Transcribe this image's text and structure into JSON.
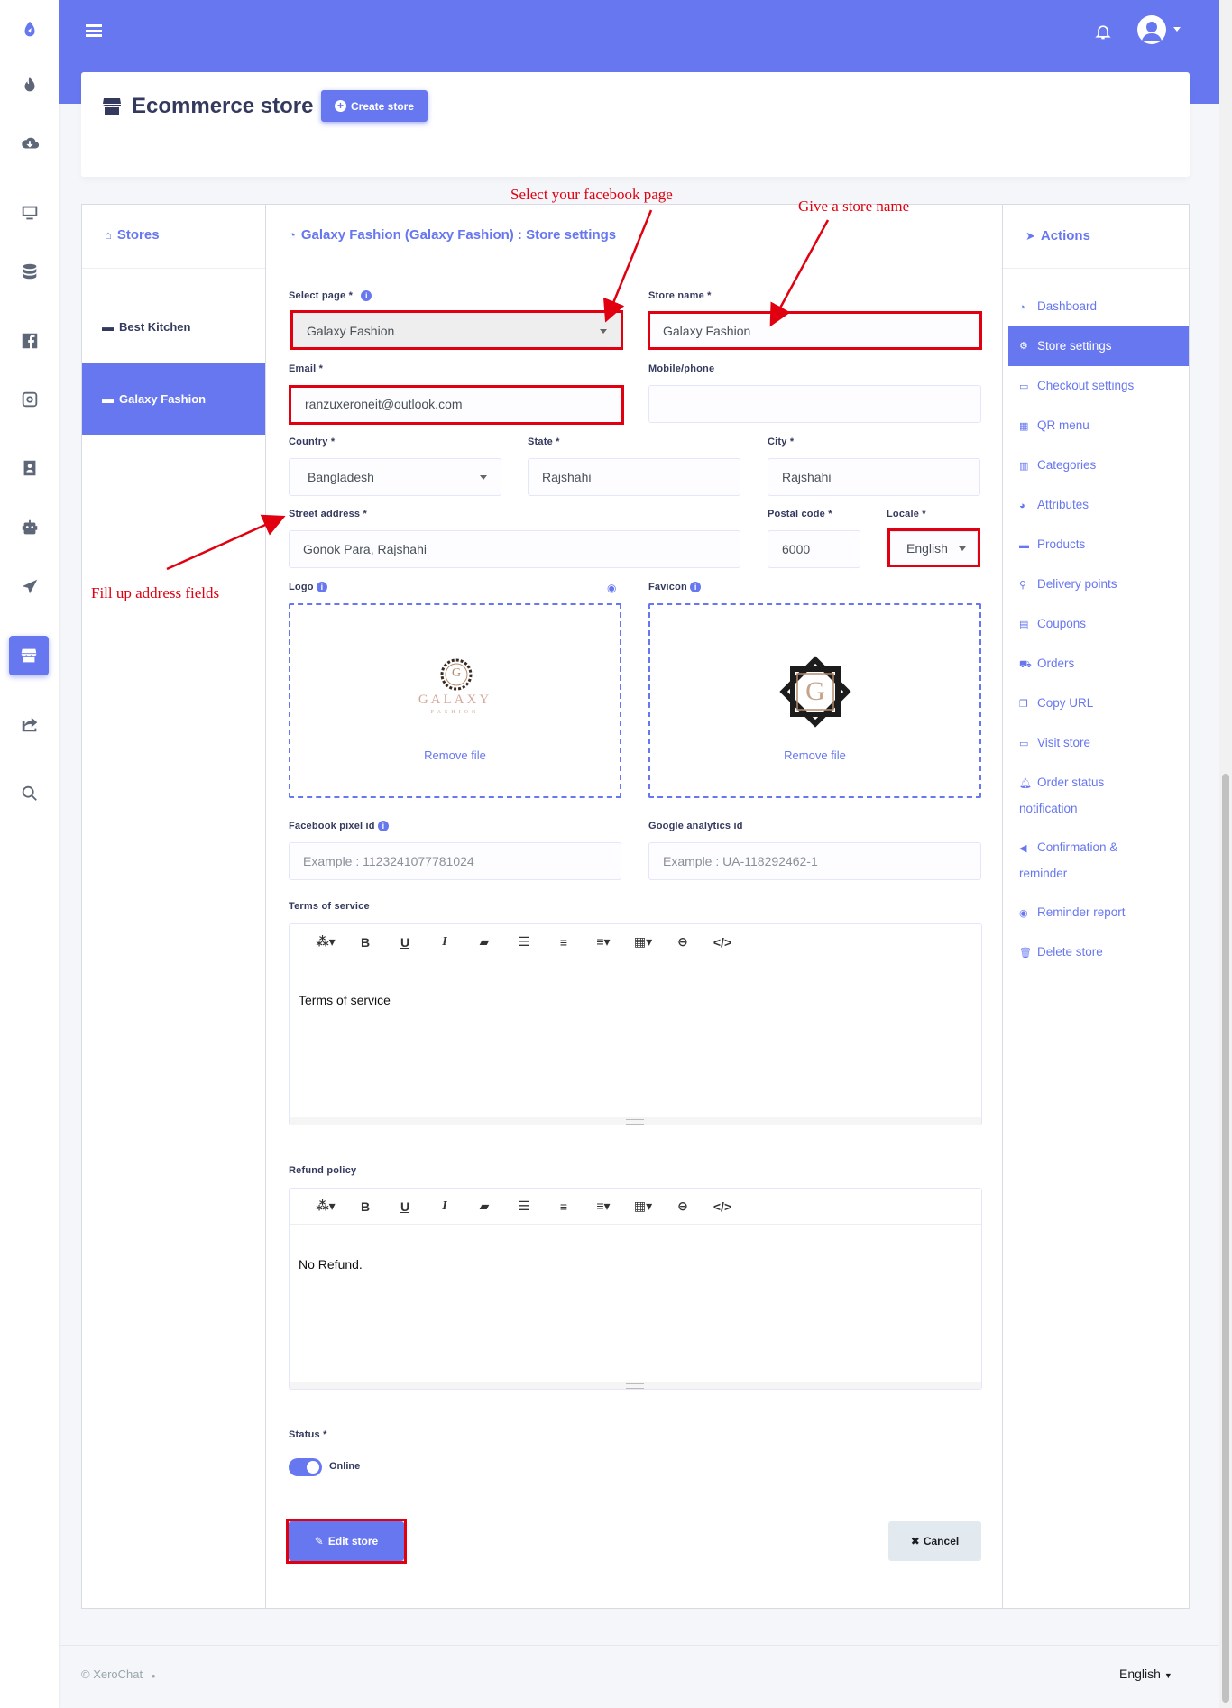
{
  "topbar": {
    "menu_icon": "hamburger-icon",
    "bell_icon": "bell-icon",
    "avatar_icon": "user-avatar-icon"
  },
  "header": {
    "title": "Ecommerce store",
    "create_button": "Create store"
  },
  "stores_panel": {
    "title": "Stores",
    "items": [
      {
        "label": "Best Kitchen"
      },
      {
        "label": "Galaxy Fashion"
      }
    ]
  },
  "settings": {
    "title": "Galaxy Fashion (Galaxy Fashion) : Store settings",
    "select_page": {
      "label": "Select page *",
      "value": "Galaxy Fashion"
    },
    "store_name": {
      "label": "Store name *",
      "value": "Galaxy Fashion"
    },
    "email": {
      "label": "Email *",
      "value": "ranzuxeroneit@outlook.com"
    },
    "mobile": {
      "label": "Mobile/phone",
      "value": ""
    },
    "country": {
      "label": "Country *",
      "value": "Bangladesh"
    },
    "state": {
      "label": "State *",
      "value": "Rajshahi"
    },
    "city": {
      "label": "City *",
      "value": "Rajshahi"
    },
    "street": {
      "label": "Street address *",
      "value": "Gonok Para, Rajshahi"
    },
    "postal": {
      "label": "Postal code *",
      "value": "6000"
    },
    "locale": {
      "label": "Locale *",
      "value": "English"
    },
    "logo": {
      "label": "Logo",
      "remove": "Remove file",
      "text": "GALAXY",
      "subtext": "FASHION",
      "brand_letter": "G"
    },
    "favicon": {
      "label": "Favicon",
      "remove": "Remove file",
      "brand_letter": "G"
    },
    "fb_pixel": {
      "label": "Facebook pixel id",
      "placeholder": "Example : 1123241077781024"
    },
    "ga": {
      "label": "Google analytics id",
      "placeholder": "Example : UA-118292462-1"
    },
    "terms": {
      "label": "Terms of service",
      "content": "Terms of service"
    },
    "refund": {
      "label": "Refund policy",
      "content": "No Refund."
    },
    "status": {
      "label": "Status *",
      "value": "Online"
    },
    "edit_button": "Edit store",
    "cancel_button": "Cancel"
  },
  "actions_panel": {
    "title": "Actions",
    "items": [
      "Dashboard",
      "Store settings",
      "Checkout settings",
      "QR menu",
      "Categories",
      "Attributes",
      "Products",
      "Delivery points",
      "Coupons",
      "Orders",
      "Copy URL",
      "Visit store",
      "Order status notification",
      "Confirmation & reminder",
      "Reminder report",
      "Delete store"
    ]
  },
  "annotations": {
    "select_page": "Select your facebook page",
    "store_name": "Give a store name",
    "address": "Fill up address fields"
  },
  "footer": {
    "copyright": "© XeroChat",
    "language": "English"
  },
  "colors": {
    "primary": "#6777ef",
    "annotation": "#e1000f"
  }
}
